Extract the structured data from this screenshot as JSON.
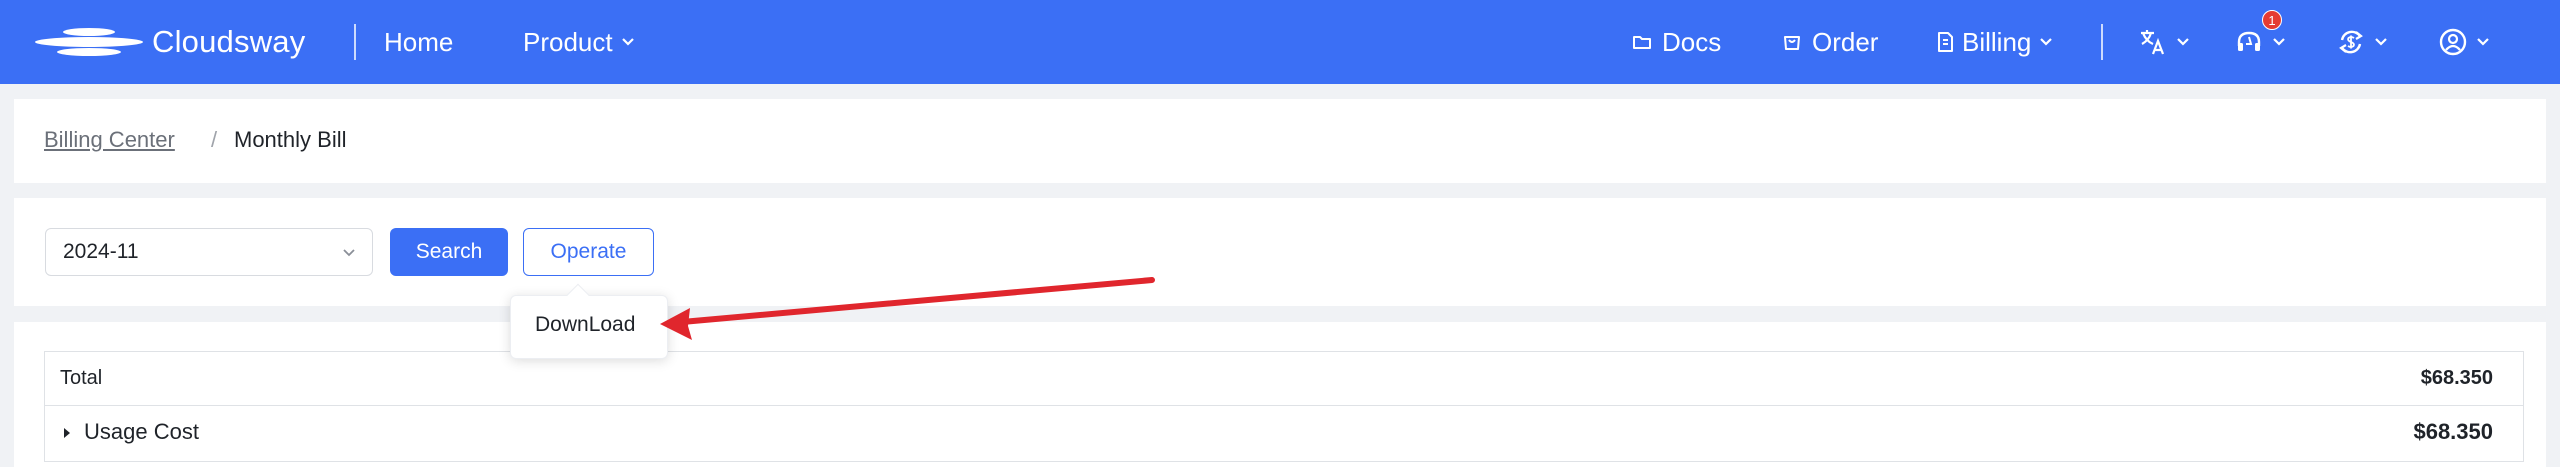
{
  "brand": {
    "name": "Cloudsway"
  },
  "nav": {
    "home": "Home",
    "product": "Product",
    "docs": "Docs",
    "order": "Order",
    "billing": "Billing",
    "notification_count": "1"
  },
  "breadcrumb": {
    "parent": "Billing Center",
    "separator": "/",
    "current": "Monthly Bill"
  },
  "filters": {
    "month_value": "2024-11",
    "search_label": "Search",
    "operate_label": "Operate"
  },
  "operate_menu": {
    "items": [
      "DownLoad"
    ]
  },
  "bill": {
    "rows": [
      {
        "label": "Total",
        "value": "$68.350"
      },
      {
        "label": "Usage Cost",
        "value": "$68.350"
      }
    ]
  },
  "colors": {
    "primary": "#3b6ff5",
    "annotation_arrow": "#e0262d",
    "badge": "#e53b32"
  }
}
